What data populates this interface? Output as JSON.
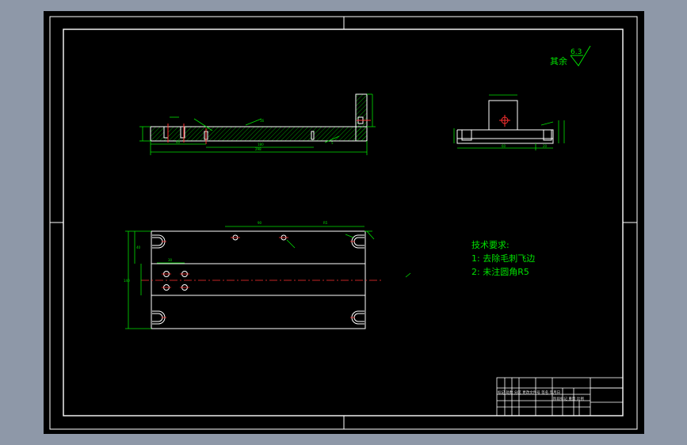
{
  "roughness": {
    "value": "6.3",
    "prefix": "其余"
  },
  "notes": {
    "title": "技术要求:",
    "items": [
      "1: 去除毛刺飞边",
      "2: 未注圆角R5"
    ]
  },
  "dimensions": {
    "front_total_length": "298",
    "front_mid_length": "180",
    "front_left_length": "40",
    "front_small_a": "16",
    "front_small_b": "5",
    "side_width": "60",
    "side_offset": "20",
    "top_dim_left": "90",
    "top_dim_right": "R5",
    "plan_height": "140",
    "plan_dim_a": "40",
    "plan_dim_b": "30"
  },
  "title_block": {
    "row_label": "标记 处数 分区 更改文件号 签名 年月日",
    "col_label": "阶段标记 重量 比例"
  },
  "colors": {
    "paper": "#000000",
    "frame": "#ffffff",
    "outline": "#ffffff",
    "dimension": "#00e000",
    "centerline": "#ff2020",
    "hatch": "#00e000",
    "notes": "#00e000",
    "titleblock_text": "#e0e0e0"
  }
}
